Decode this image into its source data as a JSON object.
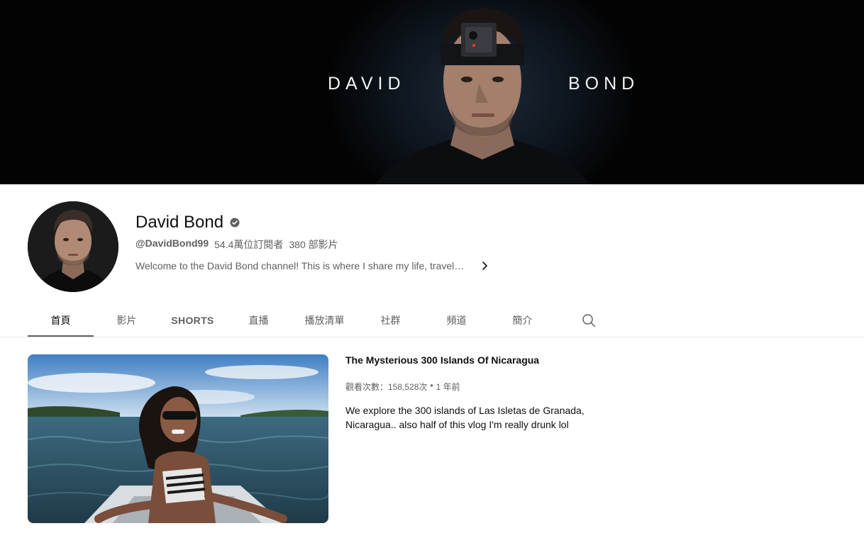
{
  "banner": {
    "word_first": "DAVID",
    "word_last": "BOND"
  },
  "channel": {
    "name": "David Bond",
    "handle": "@DavidBond99",
    "subscribers": "54.4萬位訂閱者",
    "video_count": "380 部影片",
    "description": "Welcome to the David Bond channel! This is where I share my life, travels, ..."
  },
  "tabs": [
    {
      "label": "首頁",
      "active": true
    },
    {
      "label": "影片"
    },
    {
      "label": "SHORTS"
    },
    {
      "label": "直播"
    },
    {
      "label": "播放清單"
    },
    {
      "label": "社群"
    },
    {
      "label": "頻道"
    },
    {
      "label": "簡介"
    }
  ],
  "featured_video": {
    "title": "The Mysterious 300 Islands Of Nicaragua",
    "views": "觀看次數：158,528次",
    "separator": "•",
    "age": "1 年前",
    "description": "We explore the 300 islands of Las Isletas de Granada, Nicaragua.. also half of this vlog I'm really drunk lol"
  },
  "colors": {
    "banner_bg": "#030303",
    "text_primary": "#0f0f0f",
    "text_secondary": "#606060",
    "divider": "#e5e5e5"
  },
  "icons": {
    "verified": "verified-check-icon",
    "description_more": "chevron-right-icon",
    "search": "search-icon"
  }
}
